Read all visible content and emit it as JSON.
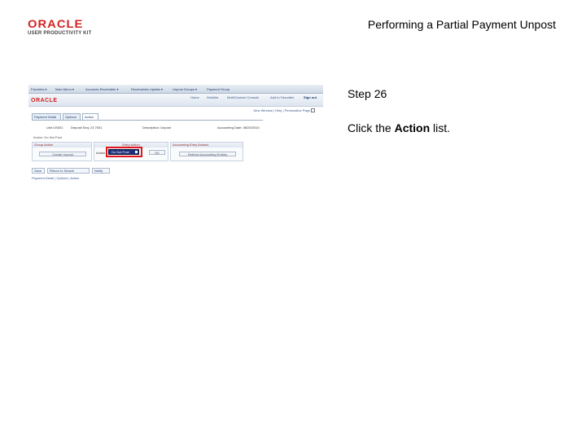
{
  "header": {
    "logo_main": "ORACLE",
    "logo_sub": "USER PRODUCTIVITY KIT",
    "title": "Performing a Partial Payment Unpost"
  },
  "instructions": {
    "step": "Step 26",
    "pre": "Click the ",
    "emphasis": "Action",
    "post": " list."
  },
  "screenshot": {
    "menu": [
      "Favorites ▾",
      "Main Menu ▾",
      "Accounts Receivable ▾",
      "Receivables Update ▾",
      "Unpost Groups ▾",
      "Payment Group"
    ],
    "logo": "ORACLE",
    "header_links": [
      "Home",
      "Worklist",
      "MultiChannel Console",
      "Add to Favorites",
      "Sign out"
    ],
    "new_window": "New Window | Help | Personalize Page",
    "tabs": [
      "Payment Detail",
      "Options",
      "Action"
    ],
    "info": {
      "unit": "Unit US001",
      "deposit": "Deposit Seq: 23 7001",
      "description": "Description: Unpost",
      "accounting_date": "Accounting Date: 08/29/2010"
    },
    "action_note": "Action: Do Not Post",
    "group_action": {
      "head": "Group Action",
      "button": "Create Unpost"
    },
    "entry_action": {
      "head": "Entry Action",
      "label": "Action",
      "value": "Do Not Post",
      "ok": "OK"
    },
    "accounting_entry_actions": {
      "head": "Accounting Entry Actions",
      "button": "Refresh Accounting Entries"
    },
    "bottom_buttons": [
      "Save",
      "Return to Search",
      "Notify"
    ],
    "footer": "Payment Detail | Options | Action"
  }
}
